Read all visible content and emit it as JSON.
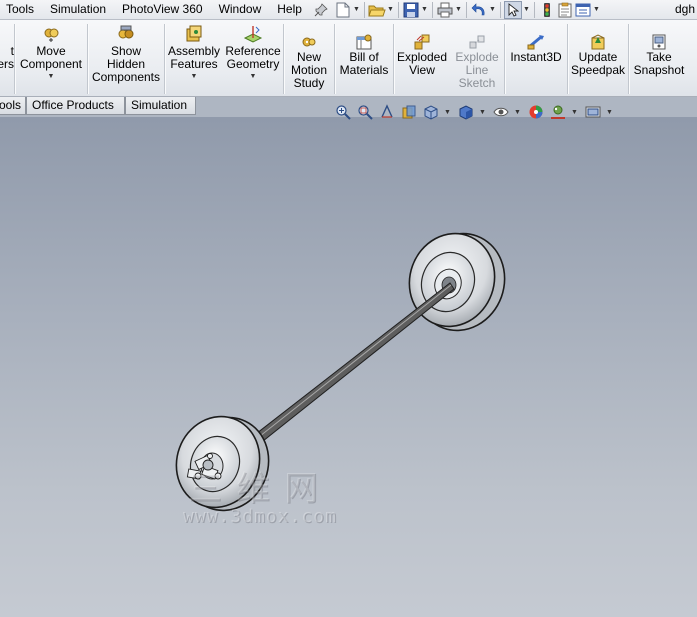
{
  "menubar": {
    "items": [
      "Tools",
      "Simulation",
      "PhotoView 360",
      "Window",
      "Help"
    ],
    "pin_icon": "pushpin-icon",
    "quick_access": [
      "new-document-icon",
      "open-folder-icon",
      "save-icon",
      "print-icon",
      "undo-icon",
      "select-arrow-icon",
      "traffic-light-rebuild-icon",
      "file-properties-icon",
      "options-icon"
    ],
    "document_title": "dgh"
  },
  "ribbon": {
    "buttons": [
      {
        "id": "smart-fasteners",
        "label": "t\ners",
        "icon": "smart-fasteners-icon",
        "dropdown": false,
        "disabled": false
      },
      {
        "id": "move-component",
        "label": "Move\nComponent",
        "icon": "move-component-icon",
        "dropdown": true,
        "disabled": false
      },
      {
        "id": "show-hidden-components",
        "label": "Show\nHidden\nComponents",
        "icon": "show-hidden-components-icon",
        "dropdown": false,
        "disabled": false
      },
      {
        "id": "assembly-features",
        "label": "Assembly\nFeatures",
        "icon": "assembly-features-icon",
        "dropdown": true,
        "disabled": false
      },
      {
        "id": "reference-geometry",
        "label": "Reference\nGeometry",
        "icon": "reference-geometry-icon",
        "dropdown": true,
        "disabled": false
      },
      {
        "id": "new-motion-study",
        "label": "New\nMotion\nStudy",
        "icon": "motion-study-icon",
        "dropdown": false,
        "disabled": false
      },
      {
        "id": "bill-of-materials",
        "label": "Bill of\nMaterials",
        "icon": "bill-of-materials-icon",
        "dropdown": false,
        "disabled": false
      },
      {
        "id": "exploded-view",
        "label": "Exploded\nView",
        "icon": "exploded-view-icon",
        "dropdown": false,
        "disabled": false
      },
      {
        "id": "explode-line-sketch",
        "label": "Explode\nLine\nSketch",
        "icon": "explode-line-sketch-icon",
        "dropdown": false,
        "disabled": true
      },
      {
        "id": "instant3d",
        "label": "Instant3D",
        "icon": "instant3d-icon",
        "dropdown": false,
        "disabled": false
      },
      {
        "id": "update-speedpak",
        "label": "Update\nSpeedpak",
        "icon": "update-speedpak-icon",
        "dropdown": false,
        "disabled": false
      },
      {
        "id": "take-snapshot",
        "label": "Take\nSnapshot",
        "icon": "take-snapshot-icon",
        "dropdown": false,
        "disabled": false
      }
    ]
  },
  "tabs": [
    "ools",
    "Office Products",
    "Simulation"
  ],
  "heads_up_toolbar": [
    "zoom-to-fit-icon",
    "zoom-to-area-icon",
    "previous-view-icon",
    "section-view-icon",
    "view-orientation-icon",
    "display-style-icon",
    "hide-show-items-icon",
    "edit-appearance-icon",
    "apply-scene-icon",
    "view-settings-icon"
  ],
  "watermark": {
    "text_cn": "三维网",
    "url": "www.3dmox.com"
  }
}
